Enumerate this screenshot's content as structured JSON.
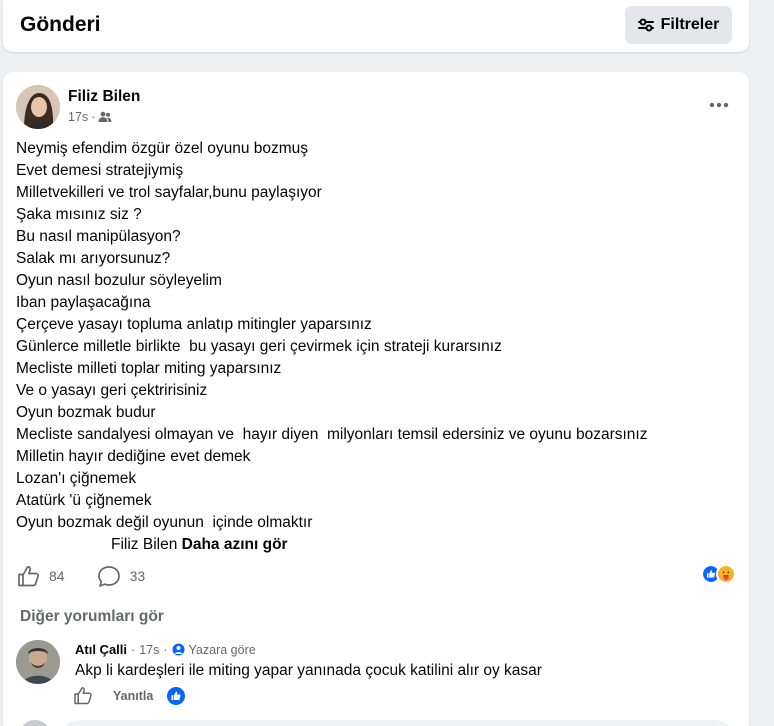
{
  "header": {
    "title": "Gönderi",
    "filter_label": "Filtreler"
  },
  "post": {
    "author": "Filiz Bilen",
    "time": "17s",
    "separator": "·",
    "lines": [
      "Neymiş efendim özgür özel oyunu bozmuş",
      "Evet demesi stratejiymiş",
      "Milletvekilleri ve trol sayfalar,bunu paylaşıyor",
      "Şaka mısınız siz ?",
      "Bu nasıl manipülasyon?",
      "Salak mı arıyorsunuz?",
      "Oyun nasıl bozulur söyleyelim",
      "Iban paylaşacağına",
      "Çerçeve yasayı topluma anlatıp mitingler yaparsınız",
      "Günlerce milletle birlikte  bu yasayı geri çevirmek için strateji kurarsınız",
      "Mecliste milleti toplar miting yaparsınız",
      "Ve o yasayı geri çektririsiniz",
      "Oyun bozmak budur",
      "Mecliste sandalyesi olmayan ve  hayır diyen  milyonları temsil edersiniz ve oyunu bozarsınız",
      "Milletin hayır dediğine evet demek",
      "Lozan'ı çiğnemek",
      "Atatürk 'ü çiğnemek",
      "Oyun bozmak değil oyunun  içinde olmaktır"
    ],
    "signature": "Filiz Bilen ",
    "see_less": "Daha azını gör",
    "like_count": "84",
    "comment_count": "33"
  },
  "comments": {
    "more_label": "Diğer yorumları gör",
    "first": {
      "name": "Atıl Çalli",
      "separator": "·",
      "time": "17s",
      "separator2": "·",
      "audience": "Yazara göre",
      "text": "Akp li kardeşleri ile miting yapar yanınada çocuk katilini alır oy kasar",
      "reply_label": "Yanıtla"
    }
  },
  "colors": {
    "accent": "#0866ff",
    "secondary_text": "#65676b",
    "button_bg": "#e4e6eb"
  }
}
